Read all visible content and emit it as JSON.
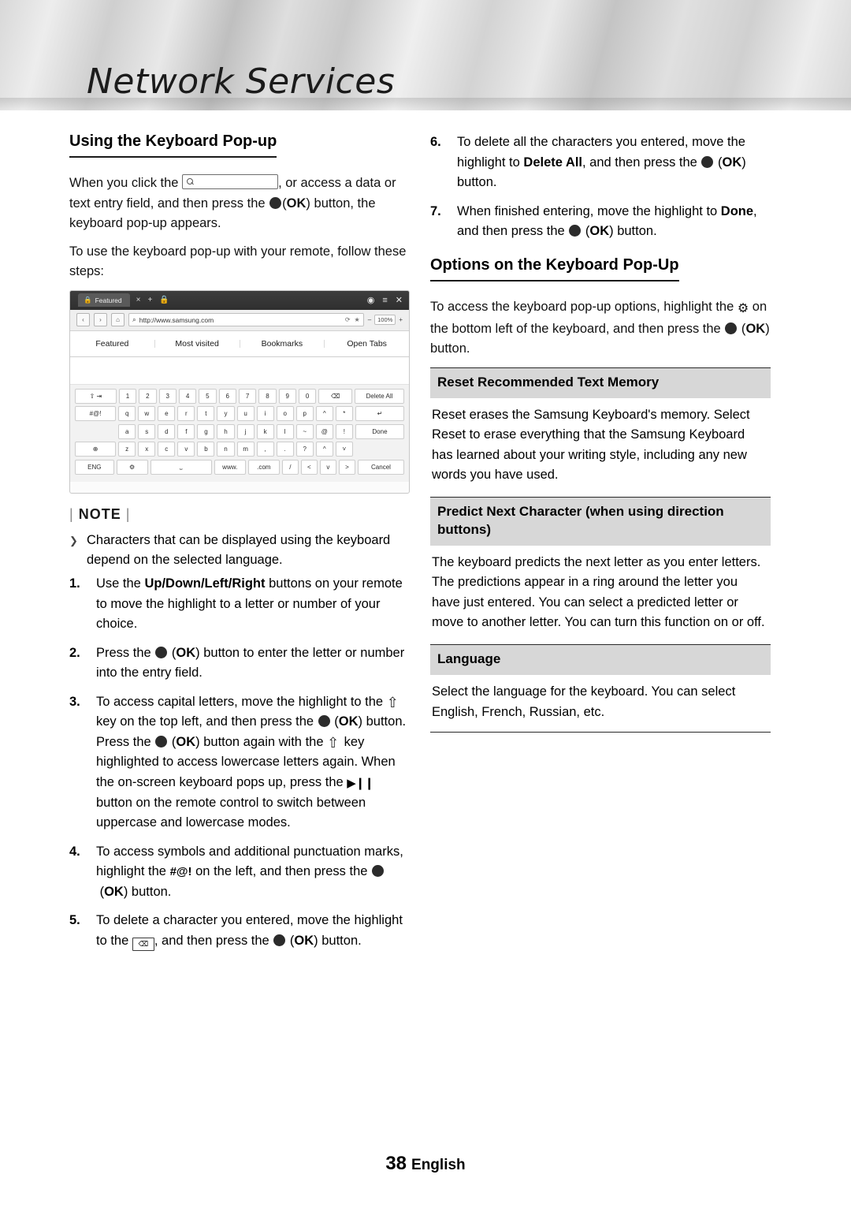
{
  "chapter": {
    "title": "Network Services"
  },
  "left": {
    "section_title": "Using the Keyboard Pop-up",
    "intro_1_a": "When you click the",
    "intro_1_b": ", or access a data or text entry field, and then press the",
    "intro_1_ok": "OK",
    "intro_1_c": "button, the keyboard pop-up appears.",
    "intro_2": "To use the keyboard pop-up with your remote, follow these steps:",
    "note_label": "NOTE",
    "note_bullet": "Characters that can be displayed using the keyboard depend on the selected language.",
    "steps": [
      {
        "num": "1.",
        "parts": [
          "Use the ",
          "Up/Down/Left/Right",
          " buttons on your remote to move the highlight to a letter or number of your choice."
        ]
      },
      {
        "num": "2.",
        "parts": [
          "Press the ",
          "OK",
          " button to enter the letter or number into the entry field."
        ]
      },
      {
        "num": "3.",
        "parts": [
          "To access capital letters, move the highlight to the ",
          "shift-key",
          " key on the top left, and then press the ",
          "OK",
          " button. Press the ",
          "OK",
          " button again with the ",
          "shift-key",
          " key highlighted to access lowercase letters again. When the on-screen keyboard pops up, press the ",
          "play-pause",
          " button on the remote control to switch between uppercase and lowercase modes."
        ]
      },
      {
        "num": "4.",
        "parts": [
          "To access symbols and additional punctuation marks, highlight the ",
          "#@!",
          " on the left, and then press the ",
          "OK",
          " button."
        ]
      },
      {
        "num": "5.",
        "parts": [
          "To delete a character you entered, move the highlight to the ",
          "backspace-key",
          ", and then press the ",
          "OK",
          " button."
        ]
      }
    ]
  },
  "right": {
    "steps": [
      {
        "num": "6.",
        "parts": [
          "To delete all the characters you entered, move the highlight to ",
          "Delete All",
          ", and then press the ",
          "OK",
          " button."
        ]
      },
      {
        "num": "7.",
        "parts": [
          "When finished entering, move the highlight to ",
          "Done",
          ", and then press the ",
          "OK",
          " button."
        ]
      }
    ],
    "section_title": "Options on the Keyboard Pop-Up",
    "options_intro_a": "To access the keyboard pop-up options, highlight the",
    "options_intro_b": "on the bottom left of the keyboard, and then press the",
    "options_intro_ok": "OK",
    "options_intro_c": "button.",
    "options": [
      {
        "head": "Reset Recommended Text Memory",
        "body": "Reset erases the Samsung Keyboard's memory. Select Reset to erase everything that the Samsung Keyboard has learned about your writing style, including any new words you have used."
      },
      {
        "head": "Predict Next Character (when using direction buttons)",
        "body": "The keyboard predicts the next letter as you enter letters. The predictions appear in a ring around the letter you have just entered. You can select a predicted letter or move to another letter. You can turn this function on or off."
      },
      {
        "head": "Language",
        "body": "Select the language for the keyboard. You can select English, French, Russian, etc."
      }
    ]
  },
  "figure": {
    "tab_label": "Featured",
    "tab_icons": [
      "×",
      "+",
      "lock-icon"
    ],
    "window_icons": [
      "user-icon",
      "menu-icon",
      "close-icon"
    ],
    "nav_buttons": [
      "‹",
      "›",
      "⌂"
    ],
    "url": "http://www.samsung.com",
    "url_icons": [
      "refresh-icon",
      "star-icon"
    ],
    "zoom": "100%",
    "zoom_minus": "–",
    "zoom_plus": "+",
    "browser_tabs": [
      "Featured",
      "Most visited",
      "Bookmarks",
      "Open Tabs"
    ],
    "keyboard": {
      "row1": [
        "⇧ ⇥",
        "1",
        "2",
        "3",
        "4",
        "5",
        "6",
        "7",
        "8",
        "9",
        "0",
        "⌫",
        "Delete All"
      ],
      "row2": [
        "#@!",
        "q",
        "w",
        "e",
        "r",
        "t",
        "y",
        "u",
        "i",
        "o",
        "p",
        "^",
        "*",
        "↵"
      ],
      "row3": [
        "a",
        "s",
        "d",
        "f",
        "g",
        "h",
        "j",
        "k",
        "l",
        "~",
        "@",
        "!",
        "Done"
      ],
      "row4_side": "⊕",
      "row4": [
        "z",
        "x",
        "c",
        "v",
        "b",
        "n",
        "m",
        ",",
        ".",
        "?",
        "^",
        "˅"
      ],
      "row5_side": "ENG",
      "row5": [
        "⚙",
        "⎵",
        "www.",
        ".com",
        "/",
        "<",
        "v",
        ">",
        "Cancel"
      ]
    }
  },
  "footer": {
    "page": "38",
    "language": "English"
  }
}
